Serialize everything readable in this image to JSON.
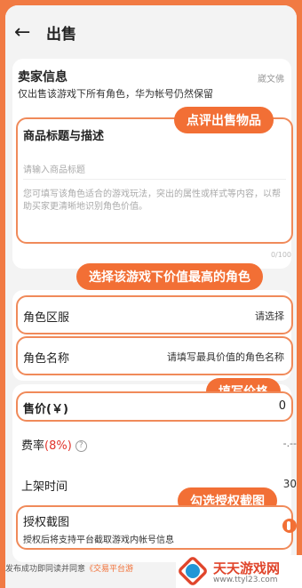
{
  "header": {
    "back_glyph": "←",
    "title": "出售"
  },
  "seller": {
    "title": "卖家信息",
    "masked_account": "崴文佛",
    "subtitle": "仅出售该游戏下所有角色，华为帐号仍然保留"
  },
  "listing": {
    "title": "商品标题与描述",
    "title_placeholder": "请输入商品标题",
    "desc_placeholder": "您可填写该角色适合的游戏玩法，突出的属性或样式等内容，以帮助买家更清晰地识别角色价值。",
    "char_count": "0/100"
  },
  "callouts": {
    "c1": "点评出售物品",
    "c2": "选择该游戏下价值最高的角色",
    "c3": "填写价格",
    "c4": "勾选授权截图"
  },
  "role": {
    "server_label": "角色区服",
    "server_value": "请选择",
    "name_label": "角色名称",
    "name_value": "请填写最具价值的角色名称"
  },
  "pricing": {
    "price_label": "售价(￥)",
    "price_value": "0",
    "fee_label": "费率",
    "fee_pct": "(8%)",
    "fee_help": "?",
    "fee_value": "-.--",
    "shelf_label": "上架时间",
    "shelf_value": "30",
    "auth_label": "授权截图",
    "auth_sub": "授权后将支持平台截取游戏内帐号信息"
  },
  "footer": {
    "text": "发布成功即同读并同意",
    "link": "《交易平台游"
  },
  "watermark": {
    "name": "天天游戏网",
    "url": "www.ttyl23.com"
  },
  "colors": {
    "accent": "#f26f35",
    "background": "#f17a43"
  }
}
